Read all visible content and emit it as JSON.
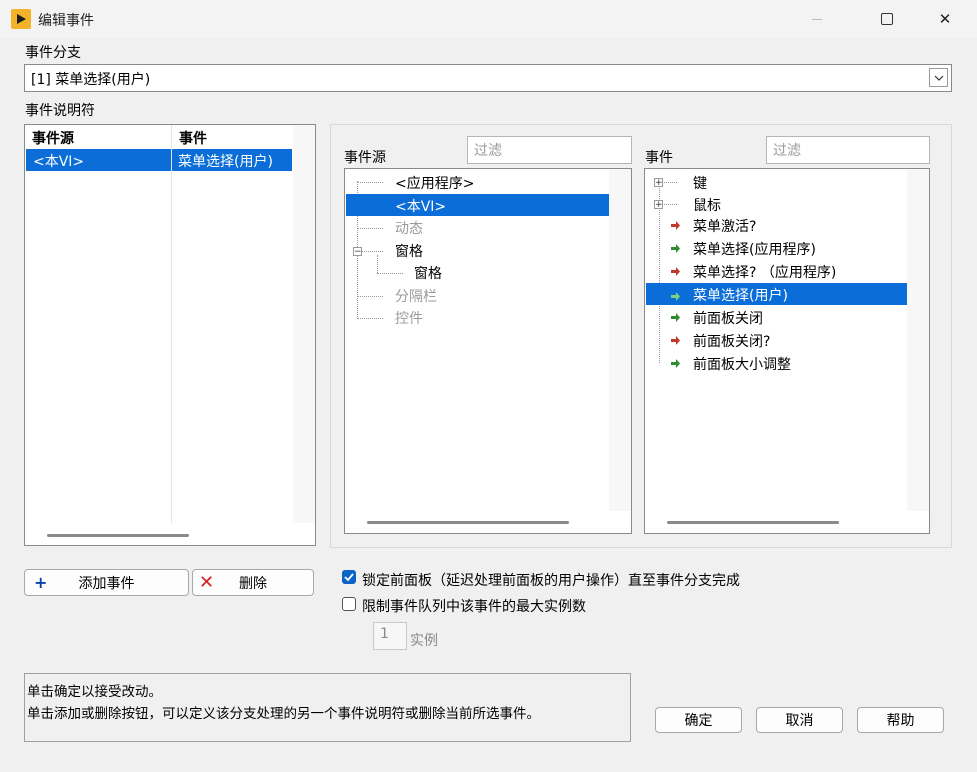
{
  "window": {
    "title": "编辑事件",
    "controls": {
      "minimize": "—",
      "maximize": "☐",
      "close": "✕"
    }
  },
  "event_case": {
    "label": "事件分支",
    "selected": "[1] 菜单选择(用户)"
  },
  "specifiers": {
    "label": "事件说明符",
    "columns": [
      "事件源",
      "事件"
    ],
    "rows": [
      {
        "source": "<本VI>",
        "event": "菜单选择(用户)"
      }
    ]
  },
  "sources": {
    "label": "事件源",
    "filter_placeholder": "过滤",
    "items": [
      {
        "text": "<应用程序>",
        "state": "normal"
      },
      {
        "text": "<本VI>",
        "state": "selected"
      },
      {
        "text": "动态",
        "state": "disabled"
      },
      {
        "text": "窗格",
        "state": "normal"
      },
      {
        "text": "窗格",
        "state": "normal"
      },
      {
        "text": "分隔栏",
        "state": "disabled"
      },
      {
        "text": "控件",
        "state": "disabled"
      }
    ]
  },
  "events": {
    "label": "事件",
    "filter_placeholder": "过滤",
    "items": [
      {
        "text": "键",
        "kind": "group"
      },
      {
        "text": "鼠标",
        "kind": "group"
      },
      {
        "text": "菜单激活?",
        "kind": "filter"
      },
      {
        "text": "菜单选择(应用程序)",
        "kind": "notify"
      },
      {
        "text": "菜单选择? （应用程序)",
        "kind": "filter"
      },
      {
        "text": "菜单选择(用户)",
        "kind": "notify",
        "selected": true
      },
      {
        "text": "前面板关闭",
        "kind": "notify"
      },
      {
        "text": "前面板关闭?",
        "kind": "filter"
      },
      {
        "text": "前面板大小调整",
        "kind": "notify"
      }
    ]
  },
  "buttons": {
    "add": "添加事件",
    "delete": "删除",
    "ok": "确定",
    "cancel": "取消",
    "help": "帮助"
  },
  "options": {
    "lock_panel": {
      "label": "锁定前面板（延迟处理前面板的用户操作）直至事件分支完成",
      "checked": true
    },
    "limit_queue": {
      "label": "限制事件队列中该事件的最大实例数",
      "checked": false
    },
    "instances": {
      "value": "1",
      "unit": "实例"
    }
  },
  "help_text": {
    "line1": "单击确定以接受改动。",
    "line2": "单击添加或删除按钮，可以定义该分支处理的另一个事件说明符或删除当前所选事件。"
  },
  "colors": {
    "selection": "#0b6dd7",
    "filter_arrow": "#c0392b",
    "notify_arrow": "#2e8b2e",
    "app_icon": "#f2b32b"
  }
}
